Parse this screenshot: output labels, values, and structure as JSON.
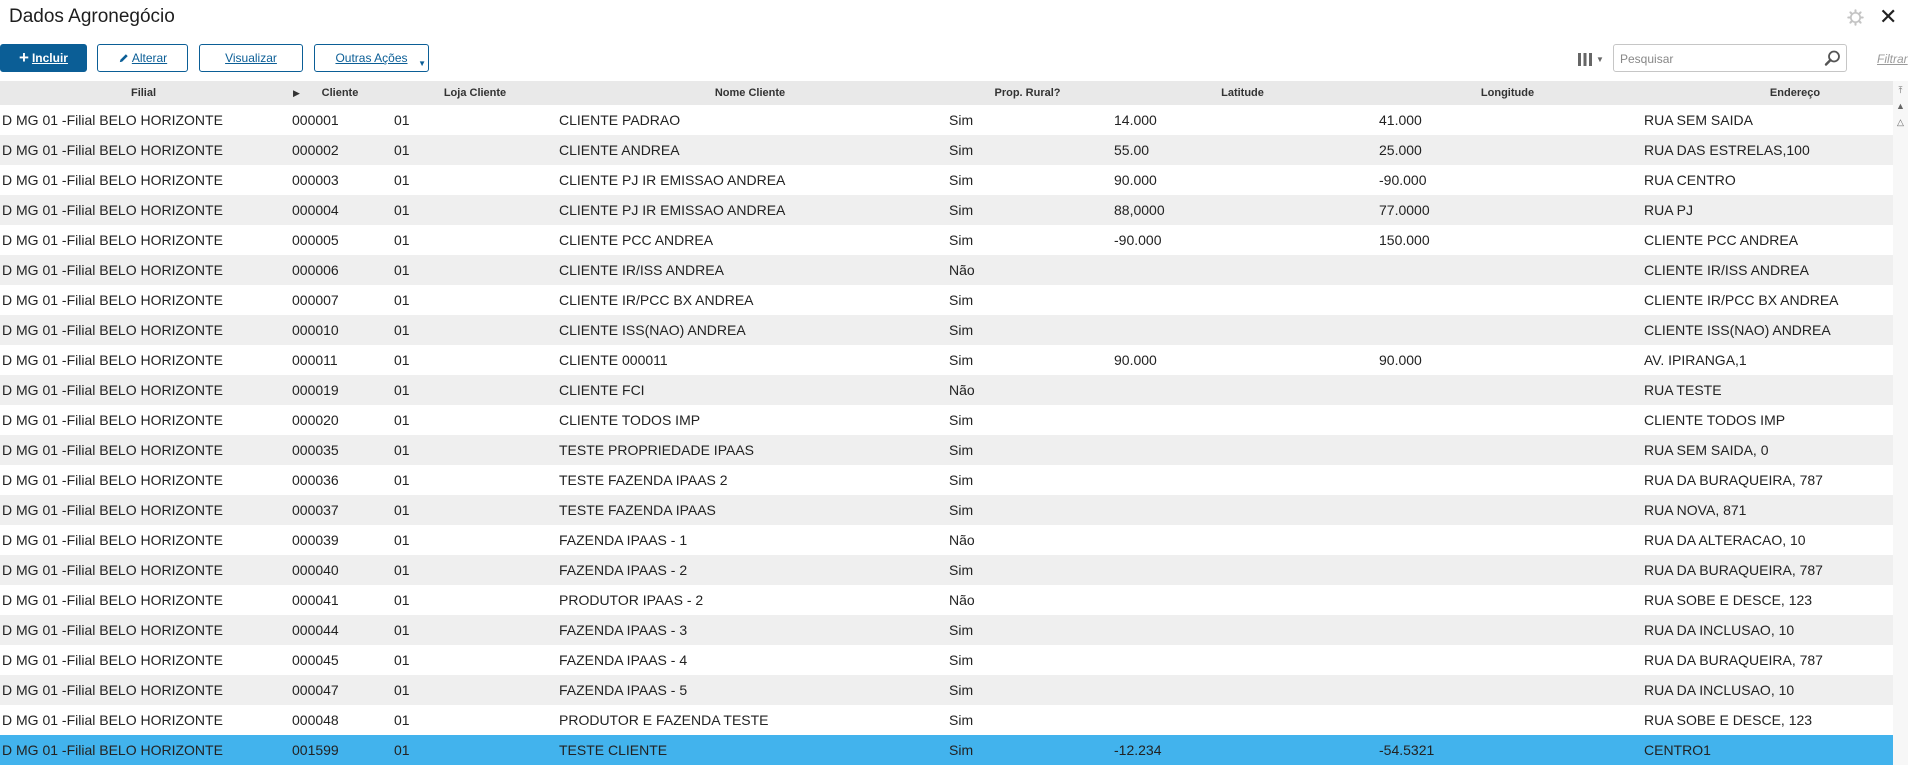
{
  "window": {
    "title": "Dados Agronegócio",
    "close_label": "✕"
  },
  "toolbar": {
    "incluir_label": "Incluir",
    "alterar_label": "Alterar",
    "visualizar_label": "Visualizar",
    "outras_label": "Outras Ações"
  },
  "search": {
    "placeholder": "Pesquisar",
    "value": ""
  },
  "filter_label": "Filtrar",
  "table": {
    "headers": [
      "Filial",
      "Cliente",
      "Loja Cliente",
      "Nome Cliente",
      "Prop. Rural?",
      "Latitude",
      "Longitude",
      "Endereço"
    ],
    "rows": [
      [
        "D MG 01 -Filial BELO HORIZONTE",
        "000001",
        "01",
        "CLIENTE PADRAO",
        "Sim",
        "14.000",
        "41.000",
        "RUA SEM SAIDA"
      ],
      [
        "D MG 01 -Filial BELO HORIZONTE",
        "000002",
        "01",
        "CLIENTE ANDREA",
        "Sim",
        "55.00",
        "25.000",
        "RUA DAS ESTRELAS,100"
      ],
      [
        "D MG 01 -Filial BELO HORIZONTE",
        "000003",
        "01",
        "CLIENTE PJ IR EMISSAO ANDREA",
        "Sim",
        "90.000",
        "-90.000",
        "RUA CENTRO"
      ],
      [
        "D MG 01 -Filial BELO HORIZONTE",
        "000004",
        "01",
        "CLIENTE PJ IR EMISSAO ANDREA",
        "Sim",
        "88,0000",
        "77.0000",
        "RUA PJ"
      ],
      [
        "D MG 01 -Filial BELO HORIZONTE",
        "000005",
        "01",
        "CLIENTE PCC ANDREA",
        "Sim",
        "-90.000",
        "150.000",
        "CLIENTE PCC ANDREA"
      ],
      [
        "D MG 01 -Filial BELO HORIZONTE",
        "000006",
        "01",
        "CLIENTE IR/ISS ANDREA",
        "Não",
        "",
        "",
        "CLIENTE IR/ISS ANDREA"
      ],
      [
        "D MG 01 -Filial BELO HORIZONTE",
        "000007",
        "01",
        "CLIENTE IR/PCC BX ANDREA",
        "Sim",
        "",
        "",
        "CLIENTE IR/PCC BX ANDREA"
      ],
      [
        "D MG 01 -Filial BELO HORIZONTE",
        "000010",
        "01",
        "CLIENTE ISS(NAO) ANDREA",
        "Sim",
        "",
        "",
        "CLIENTE ISS(NAO) ANDREA"
      ],
      [
        "D MG 01 -Filial BELO HORIZONTE",
        "000011",
        "01",
        "CLIENTE 000011",
        "Sim",
        "90.000",
        "90.000",
        "AV. IPIRANGA,1"
      ],
      [
        "D MG 01 -Filial BELO HORIZONTE",
        "000019",
        "01",
        "CLIENTE FCI",
        "Não",
        "",
        "",
        "RUA TESTE"
      ],
      [
        "D MG 01 -Filial BELO HORIZONTE",
        "000020",
        "01",
        "CLIENTE TODOS IMP",
        "Sim",
        "",
        "",
        "CLIENTE TODOS IMP"
      ],
      [
        "D MG 01 -Filial BELO HORIZONTE",
        "000035",
        "01",
        "TESTE PROPRIEDADE IPAAS",
        "Sim",
        "",
        "",
        "RUA SEM SAIDA, 0"
      ],
      [
        "D MG 01 -Filial BELO HORIZONTE",
        "000036",
        "01",
        "TESTE FAZENDA IPAAS 2",
        "Sim",
        "",
        "",
        "RUA DA BURAQUEIRA, 787"
      ],
      [
        "D MG 01 -Filial BELO HORIZONTE",
        "000037",
        "01",
        "TESTE FAZENDA IPAAS",
        "Sim",
        "",
        "",
        "RUA NOVA, 871"
      ],
      [
        "D MG 01 -Filial BELO HORIZONTE",
        "000039",
        "01",
        "FAZENDA IPAAS - 1",
        "Não",
        "",
        "",
        "RUA DA ALTERACAO, 10"
      ],
      [
        "D MG 01 -Filial BELO HORIZONTE",
        "000040",
        "01",
        "FAZENDA IPAAS - 2",
        "Sim",
        "",
        "",
        "RUA DA BURAQUEIRA, 787"
      ],
      [
        "D MG 01 -Filial BELO HORIZONTE",
        "000041",
        "01",
        "PRODUTOR IPAAS - 2",
        "Não",
        "",
        "",
        "RUA SOBE E DESCE, 123"
      ],
      [
        "D MG 01 -Filial BELO HORIZONTE",
        "000044",
        "01",
        "FAZENDA IPAAS - 3",
        "Sim",
        "",
        "",
        "RUA DA INCLUSAO, 10"
      ],
      [
        "D MG 01 -Filial BELO HORIZONTE",
        "000045",
        "01",
        "FAZENDA IPAAS - 4",
        "Sim",
        "",
        "",
        "RUA DA BURAQUEIRA, 787"
      ],
      [
        "D MG 01 -Filial BELO HORIZONTE",
        "000047",
        "01",
        "FAZENDA IPAAS - 5",
        "Sim",
        "",
        "",
        "RUA DA INCLUSAO, 10"
      ],
      [
        "D MG 01 -Filial BELO HORIZONTE",
        "000048",
        "01",
        "PRODUTOR E FAZENDA TESTE",
        "Sim",
        "",
        "",
        "RUA SOBE E DESCE, 123"
      ],
      [
        "D MG 01 -Filial BELO HORIZONTE",
        "001599",
        "01",
        "TESTE CLIENTE",
        "Sim",
        "-12.234",
        "-54.5321",
        "CENTRO1"
      ]
    ],
    "selected_row": 21
  },
  "colors": {
    "primary": "#0b5e96",
    "selected_row": "#42b3ed",
    "row_alt": "#efefef",
    "header_bg": "#e9e9e9"
  },
  "icons": {
    "incluir": "plus-icon",
    "alterar": "pencil-icon",
    "columns": "columns-icon",
    "search": "magnifier-icon",
    "settings": "gear-icon",
    "close": "close-icon"
  }
}
